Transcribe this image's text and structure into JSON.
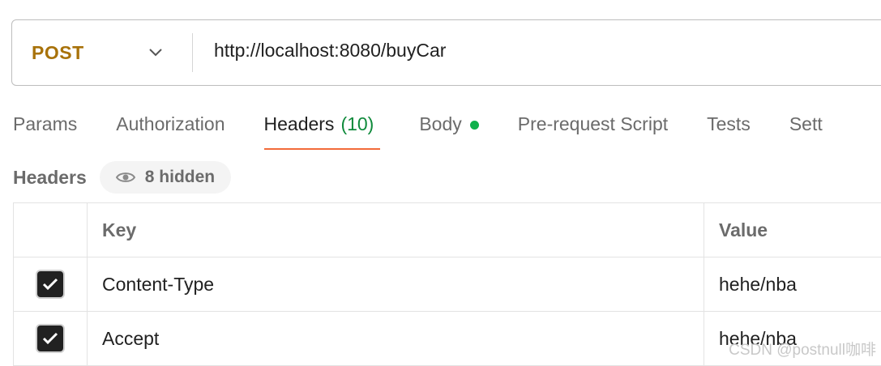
{
  "request": {
    "method": "POST",
    "url": "http://localhost:8080/buyCar"
  },
  "tabs": [
    {
      "label": "Params"
    },
    {
      "label": "Authorization"
    },
    {
      "label": "Headers",
      "count": "(10)",
      "active": true
    },
    {
      "label": "Body",
      "has_dot": true
    },
    {
      "label": "Pre-request Script"
    },
    {
      "label": "Tests"
    },
    {
      "label": "Sett"
    }
  ],
  "headers_section": {
    "title": "Headers",
    "hidden_label": "8 hidden"
  },
  "table": {
    "columns": [
      "",
      "Key",
      "Value"
    ],
    "rows": [
      {
        "checked": true,
        "key": "Content-Type",
        "value": "hehe/nba"
      },
      {
        "checked": true,
        "key": "Accept",
        "value": "hehe/nba"
      }
    ]
  },
  "watermark": "CSDN @postnull咖啡",
  "colors": {
    "method": "#a8720a",
    "tab_underline": "#f26b3a",
    "count": "#0f8a3b",
    "body_dot": "#10b14b"
  }
}
